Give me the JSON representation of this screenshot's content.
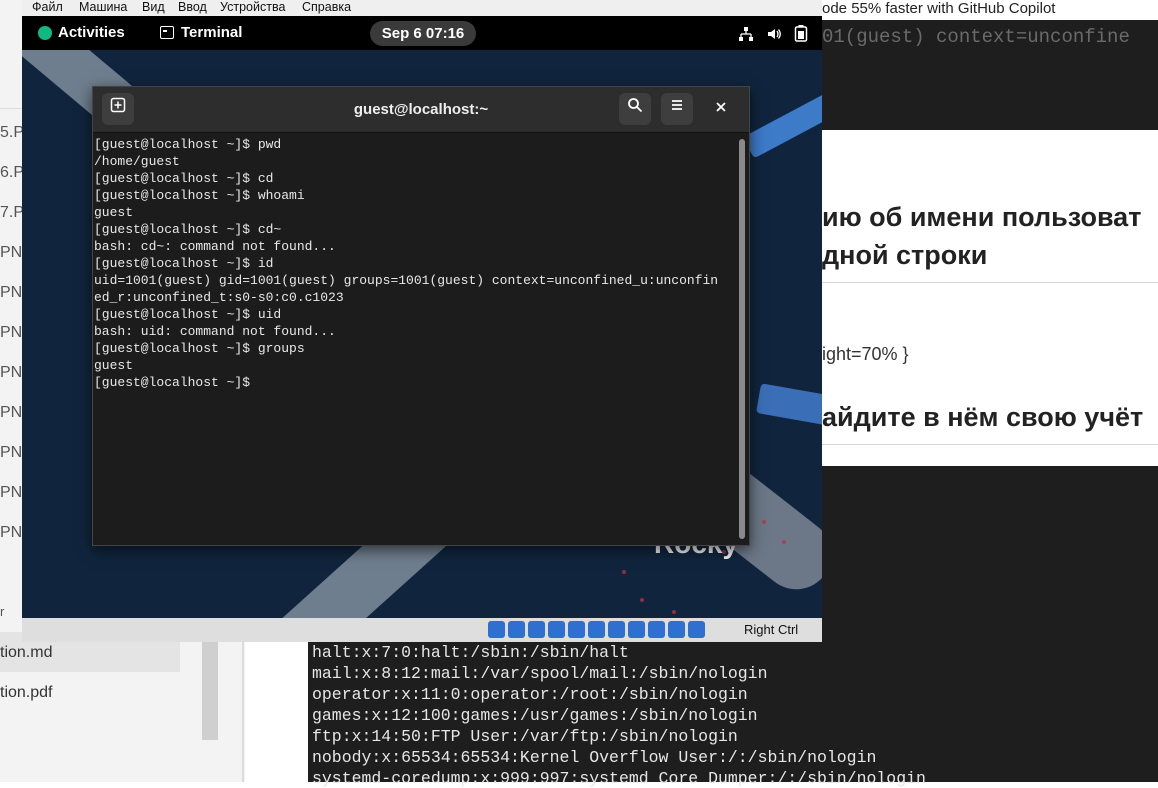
{
  "host": {
    "left_files": [
      "5.P",
      "6.P",
      "7.P",
      "PN",
      "PN",
      "PN",
      "PN",
      "PN",
      "PN",
      "PN",
      "PN"
    ],
    "left_folder_glyph": "r",
    "left_selected_file": "tion.md",
    "left_other_file": "tion.pdf",
    "copilot_banner": "ode 55% faster with GitHub Copilot",
    "top_code_fragment": "01(guest) context=unconfine",
    "doc_heading_1": "ию об имени пользоват",
    "doc_heading_2": "дной строки",
    "doc_fragment": "ight=70% }",
    "doc_heading_3": "айдите в нём свою учёт",
    "passwd_lines": [
      "halt:x:7:0:halt:/sbin:/sbin/halt",
      "mail:x:8:12:mail:/var/spool/mail:/sbin/nologin",
      "operator:x:11:0:operator:/root:/sbin/nologin",
      "games:x:12:100:games:/usr/games:/sbin/nologin",
      "ftp:x:14:50:FTP User:/var/ftp:/sbin/nologin",
      "nobody:x:65534:65534:Kernel Overflow User:/:/sbin/nologin",
      "systemd-coredump:x:999:997:systemd Core Dumper:/:/sbin/nologin"
    ]
  },
  "vm": {
    "menu": [
      "Файл",
      "Машина",
      "Вид",
      "Ввод",
      "Устройства",
      "Справка"
    ],
    "host_key": "Right Ctrl"
  },
  "gnome": {
    "activities": "Activities",
    "app_name": "Terminal",
    "clock": "Sep 6  07:16",
    "tray_icons": [
      "network-icon",
      "volume-icon",
      "battery-icon"
    ]
  },
  "desktop": {
    "logo_text": "Rocky"
  },
  "terminal": {
    "title": "guest@localhost:~",
    "new_tab_icon": "plus",
    "lines": [
      "[guest@localhost ~]$ pwd",
      "/home/guest",
      "[guest@localhost ~]$ cd",
      "[guest@localhost ~]$ whoami",
      "guest",
      "[guest@localhost ~]$ cd~",
      "bash: cd~: command not found...",
      "[guest@localhost ~]$ id",
      "uid=1001(guest) gid=1001(guest) groups=1001(guest) context=unconfined_u:unconfin",
      "ed_r:unconfined_t:s0-s0:c0.c1023",
      "[guest@localhost ~]$ uid",
      "bash: uid: command not found...",
      "[guest@localhost ~]$ groups",
      "guest",
      "[guest@localhost ~]$ "
    ]
  },
  "colors": {
    "desktop_bg": "#10253d",
    "terminal_bg": "#1c1c1c",
    "accent_green": "#10b981"
  }
}
